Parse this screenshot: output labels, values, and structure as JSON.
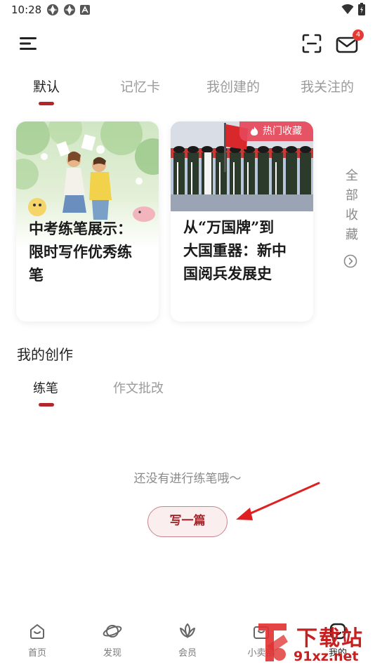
{
  "status": {
    "time": "10:28"
  },
  "header": {
    "mail_badge": "4"
  },
  "tabs": [
    {
      "label": "默认"
    },
    {
      "label": "记忆卡"
    },
    {
      "label": "我创建的"
    },
    {
      "label": "我关注的"
    }
  ],
  "cards": [
    {
      "title_lines": [
        "中考练笔展示：",
        "限时写作优秀练",
        "笔"
      ]
    },
    {
      "tag": "热门收藏",
      "title_lines": [
        "从“万国牌”到",
        "大国重器：新中",
        "国阅兵发展史"
      ]
    }
  ],
  "all_favorites": {
    "label": "全部收藏"
  },
  "creation": {
    "title": "我的创作",
    "tabs": [
      {
        "label": "练笔"
      },
      {
        "label": "作文批改"
      }
    ],
    "empty_text": "还没有进行练笔哦～",
    "write_button": "写一篇"
  },
  "bottom_nav": [
    {
      "label": "首页"
    },
    {
      "label": "发现"
    },
    {
      "label": "会员"
    },
    {
      "label": "小卖部"
    },
    {
      "label": "我的"
    }
  ],
  "watermark": {
    "text_top": "下载站",
    "text_bottom": "91xz.net"
  },
  "colors": {
    "accent": "#b3262c",
    "hot_tag": "#e6465a",
    "badge": "#e53935"
  }
}
